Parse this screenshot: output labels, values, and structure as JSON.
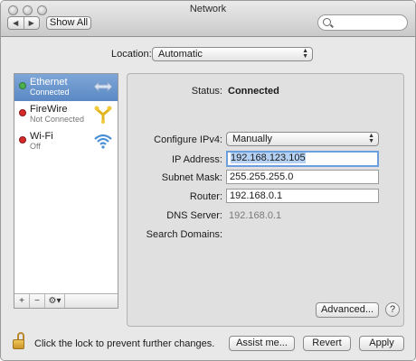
{
  "window": {
    "title": "Network",
    "nav_back": "◀",
    "nav_forward": "▶",
    "show_all_label": "Show All",
    "search_placeholder": ""
  },
  "location": {
    "label": "Location:",
    "value": "Automatic"
  },
  "sidebar": {
    "items": [
      {
        "name": "Ethernet",
        "status": "Connected",
        "status_color": "#4caf50",
        "icon": "ethernet-arrows-icon",
        "selected": true
      },
      {
        "name": "FireWire",
        "status": "Not Connected",
        "status_color": "#d42a2a",
        "icon": "firewire-icon",
        "selected": false
      },
      {
        "name": "Wi-Fi",
        "status": "Off",
        "status_color": "#d42a2a",
        "icon": "wifi-icon",
        "selected": false
      }
    ],
    "toolbar": {
      "add": "+",
      "remove": "−",
      "action": "⚙▾"
    }
  },
  "details": {
    "status_label": "Status:",
    "status_value": "Connected",
    "configure_label": "Configure IPv4:",
    "configure_value": "Manually",
    "ip_label": "IP Address:",
    "ip_value": "192.168.123.105",
    "subnet_label": "Subnet Mask:",
    "subnet_value": "255.255.255.0",
    "router_label": "Router:",
    "router_value": "192.168.0.1",
    "dns_label": "DNS Server:",
    "dns_value": "192.168.0.1",
    "search_domains_label": "Search Domains:",
    "advanced_label": "Advanced...",
    "help_label": "?"
  },
  "footer": {
    "lock_text": "Click the lock to prevent further changes.",
    "assist_label": "Assist me...",
    "revert_label": "Revert",
    "apply_label": "Apply"
  },
  "colors": {
    "selection": "#5b88c4",
    "focus_ring": "#6d9fdc"
  }
}
